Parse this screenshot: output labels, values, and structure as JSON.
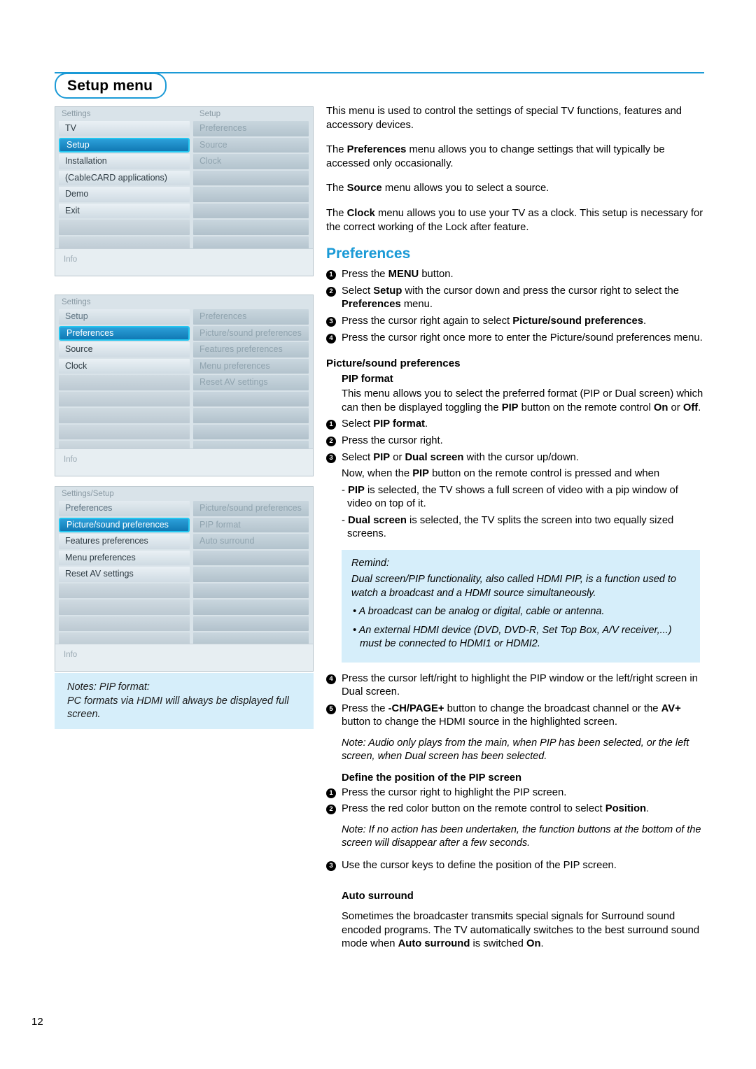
{
  "page": {
    "title": "Setup menu",
    "page_number": "12",
    "accent_color": "#1b9ad6",
    "highlight_box_color": "#d6eefa"
  },
  "menus": [
    {
      "name": "settings-setup-menu",
      "header_left": "Settings",
      "header_right": "Setup",
      "left_items": [
        {
          "label": "TV",
          "state": "normal"
        },
        {
          "label": "Setup",
          "state": "selected"
        },
        {
          "label": "Installation",
          "state": "normal"
        },
        {
          "label": "(CableCARD applications)",
          "state": "normal"
        },
        {
          "label": "Demo",
          "state": "normal"
        },
        {
          "label": "Exit",
          "state": "normal"
        },
        {
          "label": "",
          "state": "blank"
        },
        {
          "label": "",
          "state": "blank"
        }
      ],
      "right_items": [
        {
          "label": "Preferences",
          "state": "dim"
        },
        {
          "label": "Source",
          "state": "dim"
        },
        {
          "label": "Clock",
          "state": "dim"
        },
        {
          "label": "",
          "state": "blank-r"
        },
        {
          "label": "",
          "state": "blank-r"
        },
        {
          "label": "",
          "state": "blank-r"
        },
        {
          "label": "",
          "state": "blank-r"
        },
        {
          "label": "",
          "state": "blank-r"
        }
      ],
      "info_label": "Info"
    },
    {
      "name": "setup-preferences-menu",
      "header_left": "Settings",
      "header_right": "",
      "left_items": [
        {
          "label": "Setup",
          "state": "hdrrow"
        },
        {
          "label": "Preferences",
          "state": "selected"
        },
        {
          "label": "Source",
          "state": "normal"
        },
        {
          "label": "Clock",
          "state": "normal"
        },
        {
          "label": "",
          "state": "blank"
        },
        {
          "label": "",
          "state": "blank"
        },
        {
          "label": "",
          "state": "blank"
        },
        {
          "label": "",
          "state": "blank"
        },
        {
          "label": "",
          "state": "blank"
        }
      ],
      "right_items": [
        {
          "label": "Preferences",
          "state": "hdrrow-dim"
        },
        {
          "label": "Picture/sound preferences",
          "state": "dim"
        },
        {
          "label": "Features preferences",
          "state": "dim"
        },
        {
          "label": "Menu preferences",
          "state": "dim"
        },
        {
          "label": "Reset AV settings",
          "state": "dim"
        },
        {
          "label": "",
          "state": "blank-r"
        },
        {
          "label": "",
          "state": "blank-r"
        },
        {
          "label": "",
          "state": "blank-r"
        },
        {
          "label": "",
          "state": "blank-r"
        }
      ],
      "info_label": "Info"
    },
    {
      "name": "picture-sound-preferences-menu",
      "header_left": "Settings/Setup",
      "header_right": "",
      "left_items": [
        {
          "label": "Preferences",
          "state": "hdrrow"
        },
        {
          "label": "Picture/sound preferences",
          "state": "selected"
        },
        {
          "label": "Features preferences",
          "state": "normal"
        },
        {
          "label": "Menu preferences",
          "state": "normal"
        },
        {
          "label": "Reset AV settings",
          "state": "normal"
        },
        {
          "label": "",
          "state": "blank"
        },
        {
          "label": "",
          "state": "blank"
        },
        {
          "label": "",
          "state": "blank"
        },
        {
          "label": "",
          "state": "blank"
        }
      ],
      "right_items": [
        {
          "label": "Picture/sound preferences",
          "state": "hdrrow-dim"
        },
        {
          "label": "PIP format",
          "state": "dim"
        },
        {
          "label": "Auto surround",
          "state": "dim"
        },
        {
          "label": "",
          "state": "blank-r"
        },
        {
          "label": "",
          "state": "blank-r"
        },
        {
          "label": "",
          "state": "blank-r"
        },
        {
          "label": "",
          "state": "blank-r"
        },
        {
          "label": "",
          "state": "blank-r"
        },
        {
          "label": "",
          "state": "blank-r"
        }
      ],
      "info_label": "Info"
    }
  ],
  "notes_box": {
    "line1": "Notes: PIP format:",
    "line2": "PC formats via HDMI will always be displayed full screen."
  },
  "intro": {
    "p1": "This menu is used to control the settings of special TV functions, features and accessory devices.",
    "p2_pre": "The ",
    "p2_b": "Preferences",
    "p2_post": " menu allows you to change settings that will typically be accessed only occasionally.",
    "p3_pre": "The ",
    "p3_b": "Source",
    "p3_post": " menu allows you to select a source.",
    "p4_pre": "The ",
    "p4_b": "Clock",
    "p4_post": " menu allows you to use your TV as a clock. This setup is necessary for the correct working of the Lock after feature."
  },
  "preferences": {
    "heading": "Preferences",
    "steps": [
      {
        "num": "1",
        "html_pre": "Press the ",
        "bold": "MENU",
        "html_post": " button."
      },
      {
        "num": "2",
        "html_pre": "Select ",
        "bold": "Setup",
        "html_post": " with the cursor down and press the cursor right to select the ",
        "bold2": "Preferences",
        "html_post2": " menu."
      },
      {
        "num": "3",
        "html_pre": "Press the cursor right again to select ",
        "bold": "Picture/sound preferences",
        "html_post": "."
      },
      {
        "num": "4",
        "html_pre": "Press the cursor right once more to enter the Picture/sound preferences menu.",
        "bold": "",
        "html_post": ""
      }
    ]
  },
  "picture_sound": {
    "heading": "Picture/sound preferences",
    "pip_format_heading": "PIP format",
    "pip_intro_pre": "This menu allows you to select the preferred format (PIP or Dual screen) which can then be displayed toggling the ",
    "pip_intro_b1": "PIP",
    "pip_intro_mid": " button on the remote control ",
    "pip_intro_b2": "On",
    "pip_intro_mid2": " or ",
    "pip_intro_b3": "Off",
    "pip_intro_end": ".",
    "steps": [
      {
        "num": "1",
        "pre": "Select ",
        "bold": "PIP format",
        "post": "."
      },
      {
        "num": "2",
        "pre": "Press the cursor right.",
        "bold": "",
        "post": ""
      },
      {
        "num": "3",
        "pre": "Select ",
        "bold": "PIP",
        "mid": " or ",
        "bold2": "Dual screen",
        "post": " with the cursor up/down."
      }
    ],
    "after_step3_pre": "Now, when the ",
    "after_step3_b": "PIP",
    "after_step3_post": " button on the remote control is pressed and when",
    "dash1_b": "PIP",
    "dash1_post": " is selected, the TV shows a full screen of video with a pip window of video on top of it.",
    "dash2_b": "Dual screen",
    "dash2_post": " is selected, the TV splits the screen into two equally sized screens.",
    "remind": {
      "title": "Remind:",
      "body": "Dual screen/PIP functionality, also called HDMI PIP, is a function used to watch a broadcast and a HDMI source simultaneously.",
      "bullet1": "• A broadcast can be analog or digital, cable or antenna.",
      "bullet2": "• An external HDMI device (DVD, DVD-R, Set Top Box, A/V receiver,...) must be connected to HDMI1 or HDMI2."
    },
    "step4": {
      "num": "4",
      "text": "Press the cursor left/right to highlight the PIP window or the left/right screen in Dual screen."
    },
    "step5": {
      "num": "5",
      "pre": "Press the ",
      "bold": "-CH/PAGE+",
      "mid": " button to change the broadcast channel or the ",
      "bold2": "AV+",
      "post": " button to change the HDMI source in the highlighted screen."
    },
    "note_audio": "Note: Audio only plays from the main, when PIP has been selected, or the left screen, when Dual screen has been selected.",
    "position_heading": "Define the position of the PIP screen",
    "pos_steps": [
      {
        "num": "1",
        "pre": "Press the cursor right to highlight the PIP screen.",
        "bold": "",
        "post": ""
      },
      {
        "num": "2",
        "pre": "Press the red color button on the remote control to select ",
        "bold": "Position",
        "post": "."
      },
      {
        "num": "3",
        "pre": "Use the cursor keys to define the position of the PIP screen.",
        "bold": "",
        "post": ""
      }
    ],
    "note_position": "Note: If no action has been undertaken, the function buttons at the bottom of the screen will disappear after a few seconds.",
    "auto_surround_heading": "Auto surround",
    "auto_surround_pre": "Sometimes the broadcaster transmits special signals for Surround sound encoded programs. The TV automatically switches to the best surround sound mode when ",
    "auto_surround_b1": "Auto surround",
    "auto_surround_mid": " is switched ",
    "auto_surround_b2": "On",
    "auto_surround_end": "."
  }
}
